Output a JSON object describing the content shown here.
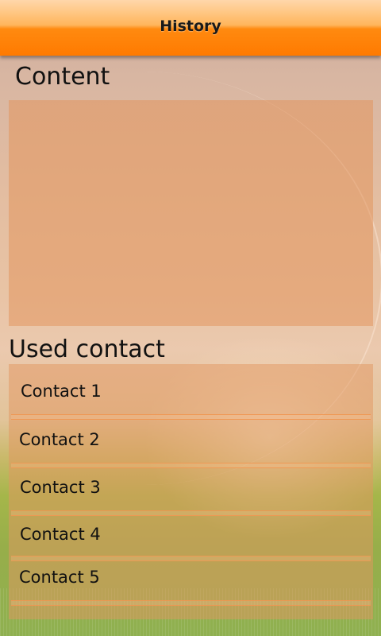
{
  "header": {
    "title": "History"
  },
  "content_section": {
    "heading": "Content"
  },
  "used_contact_section": {
    "heading": "Used contact",
    "items": [
      {
        "label": "Contact 1"
      },
      {
        "label": "Contact 2"
      },
      {
        "label": "Contact 3"
      },
      {
        "label": "Contact 4"
      },
      {
        "label": "Contact 5"
      }
    ]
  },
  "colors": {
    "header_accent": "#ff7a00",
    "panel_fill": "#e2965f"
  }
}
